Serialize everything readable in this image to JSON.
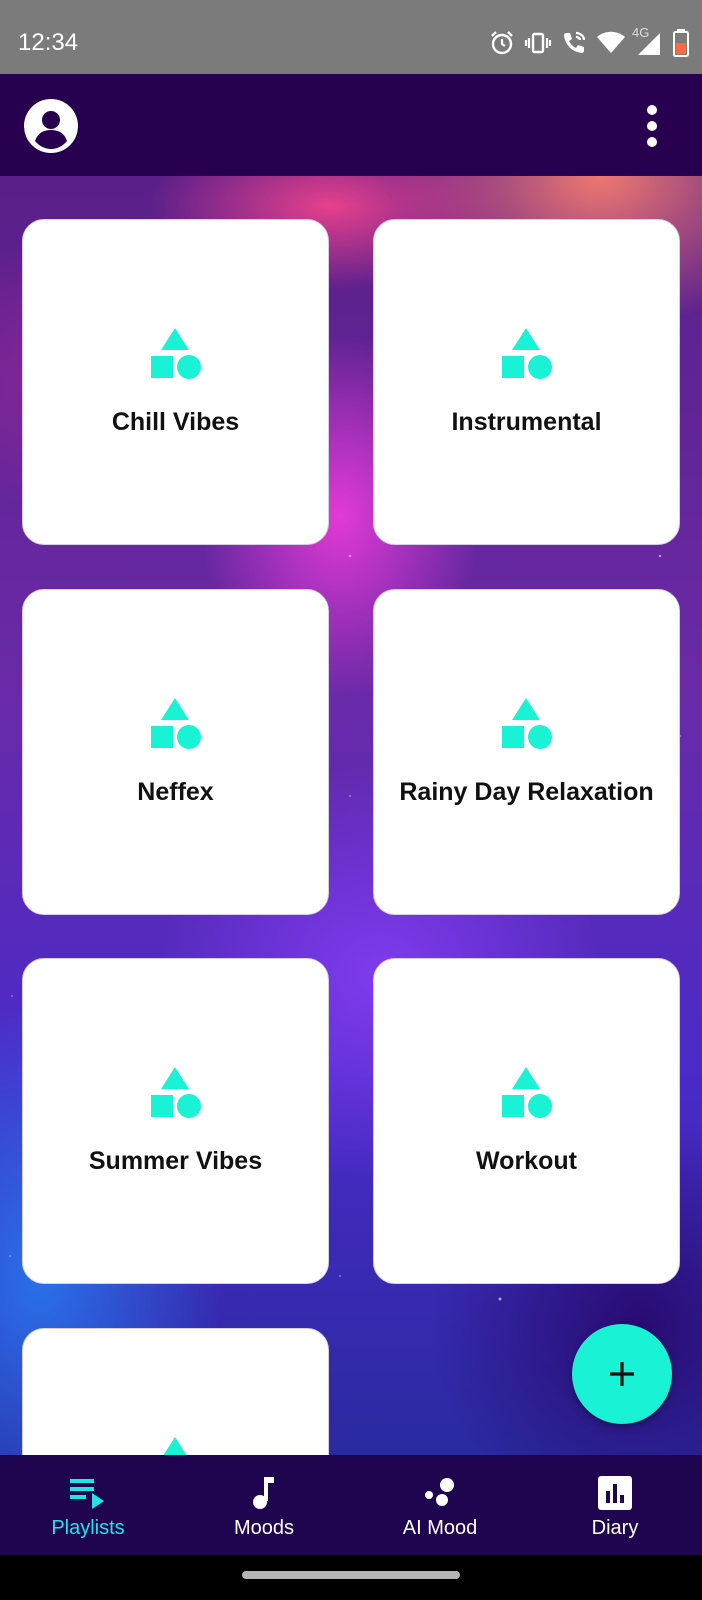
{
  "status_bar": {
    "time": "12:34",
    "network": "4G",
    "icons": [
      "alarm-icon",
      "vibrate-icon",
      "wifi-call-icon",
      "wifi-icon",
      "signal-icon",
      "battery-icon"
    ]
  },
  "app_bar": {
    "icons": [
      "account-circle-icon",
      "more-vert-icon"
    ]
  },
  "playlists": [
    {
      "label": "Chill Vibes"
    },
    {
      "label": "Instrumental"
    },
    {
      "label": "Neffex"
    },
    {
      "label": "Rainy Day Relaxation"
    },
    {
      "label": "Summer Vibes"
    },
    {
      "label": "Workout"
    },
    {
      "label": ""
    }
  ],
  "fab": {
    "icon": "plus-icon"
  },
  "bottom_nav": {
    "items": [
      {
        "label": "Playlists",
        "icon": "playlist-icon",
        "active": true
      },
      {
        "label": "Moods",
        "icon": "music-note-icon",
        "active": false
      },
      {
        "label": "AI Mood",
        "icon": "bubbles-icon",
        "active": false
      },
      {
        "label": "Diary",
        "icon": "bar-chart-icon",
        "active": false
      }
    ]
  },
  "colors": {
    "app_bar": "#27004f",
    "accent": "#19f2d4",
    "nav_active": "#1ee6e6",
    "bottom_nav": "#1f0550",
    "status_bar": "#7b7b7b"
  }
}
